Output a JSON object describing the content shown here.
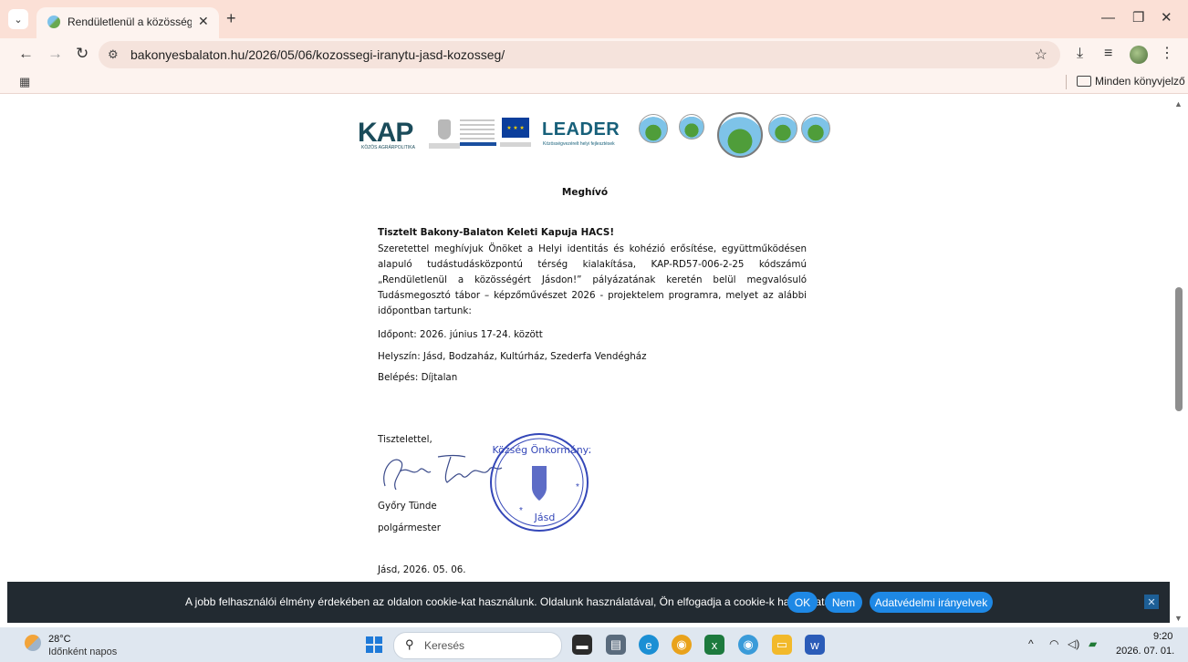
{
  "browser": {
    "tab_title": "Rendületlenül a közösségért Jásd",
    "new_tab_label": "+",
    "url": "bakonyesbalaton.hu/2026/05/06/kozossegi-iranytu-jasd-kozosseg/",
    "bookmarks_label": "Minden könyvjelző"
  },
  "logos": {
    "kap_text": "KAP",
    "kap_subtitle": "KÖZÖS AGRÁRPOLITIKA",
    "leader_text": "LEADER",
    "leader_subtitle": "Közösségvezérelt helyi fejlesztések"
  },
  "letter": {
    "title": "Meghívó",
    "salutation": "Tisztelt Bakony-Balaton Keleti Kapuja HACS!",
    "body": "Szeretettel meghívjuk Önöket a Helyi identitás és kohézió erősítése, együttműködésen alapuló tudástudásközpontú térség kialakítása, KAP-RD57-006-2-25 kódszámú „Rendületlenül a közösségért Jásdon!” pályázatának keretén belül megvalósuló Tudásmegosztó tábor – képzőművészet 2026 - projektelem programra, melyet az alábbi időpontban tartunk:",
    "date_line": "Időpont: 2026. június 17-24. között",
    "place_line": "Helyszín: Jásd, Bodzaház, Kultúrház, Szederfa Vendégház",
    "entry_line": "Belépés: Díjtalan",
    "closing": "Tisztelettel,",
    "signer_name": "Győry Tünde",
    "signer_title": "polgármester",
    "place_date": "Jásd, 2026. 05. 06.",
    "stamp_text": "Jásd Község Önkormányzata",
    "stamp_place": "Jásd"
  },
  "cookie_bar": {
    "message": "A jobb felhasználói élmény érdekében az oldalon cookie-kat használunk. Oldalunk használatával, Ön elfogadja a cookie-k használatát.",
    "ok_label": "OK",
    "no_label": "Nem",
    "privacy_label": "Adatvédelmi irányelvek"
  },
  "taskbar": {
    "temperature": "28°C",
    "weather": "Időnként napos",
    "search_placeholder": "Keresés",
    "time": "9:20",
    "date": "2026. 07. 01."
  }
}
